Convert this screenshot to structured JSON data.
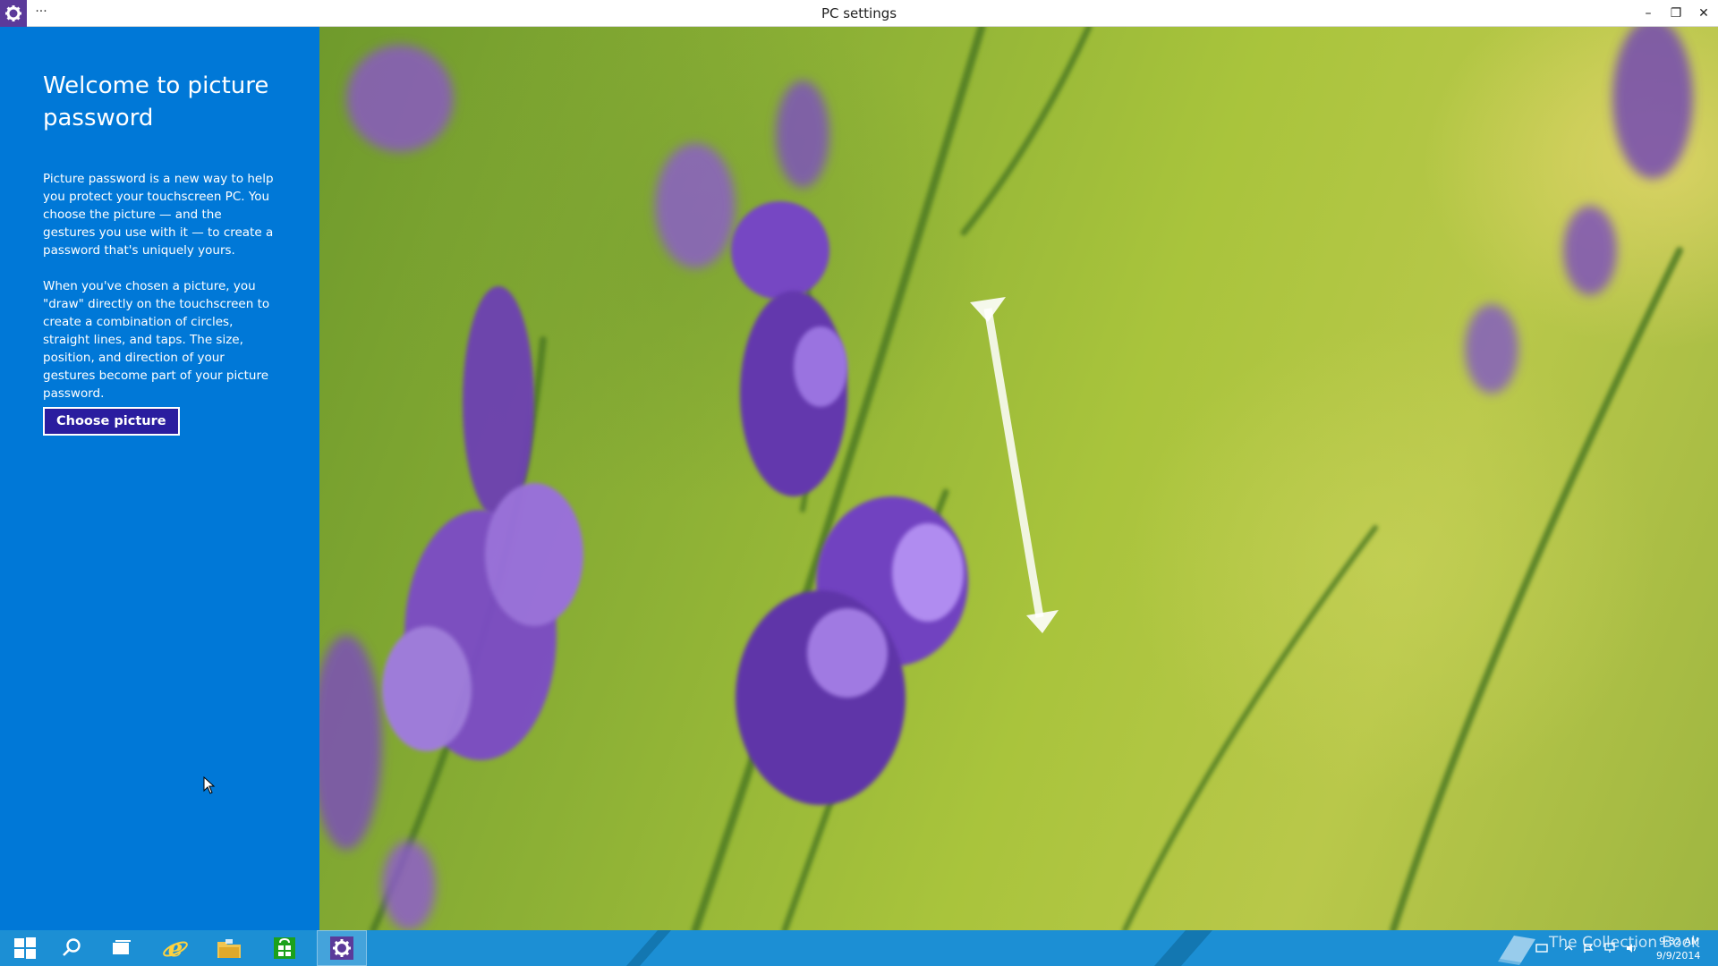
{
  "window": {
    "title": "PC settings",
    "more_label": "···",
    "minimize_label": "–",
    "maximize_label": "❐",
    "close_label": "✕"
  },
  "panel": {
    "title": "Welcome to picture password",
    "paragraph_1": "Picture password is a new way to help you protect your touchscreen PC. You choose the picture — and the gestures you use with it — to create a password that's uniquely yours.",
    "paragraph_2": "When you've chosen a picture, you \"draw\" directly on the touchscreen to create a combination of circles, straight lines, and taps. The size, position, and direction of your gestures become part of your picture password.",
    "choose_button": "Choose picture"
  },
  "taskbar": {
    "items": [
      "start-icon",
      "search-icon",
      "task-view-icon",
      "internet-explorer-icon",
      "file-explorer-icon",
      "store-icon",
      "settings-icon"
    ],
    "watermark": "The Collection Book",
    "time": "9:32 AM",
    "date": "9/9/2014"
  },
  "colors": {
    "panel_bg": "#0078d7",
    "button_bg": "#2a1d9f",
    "taskbar_bg": "#1c8fd4",
    "app_icon_bg": "#5b3a9a"
  }
}
